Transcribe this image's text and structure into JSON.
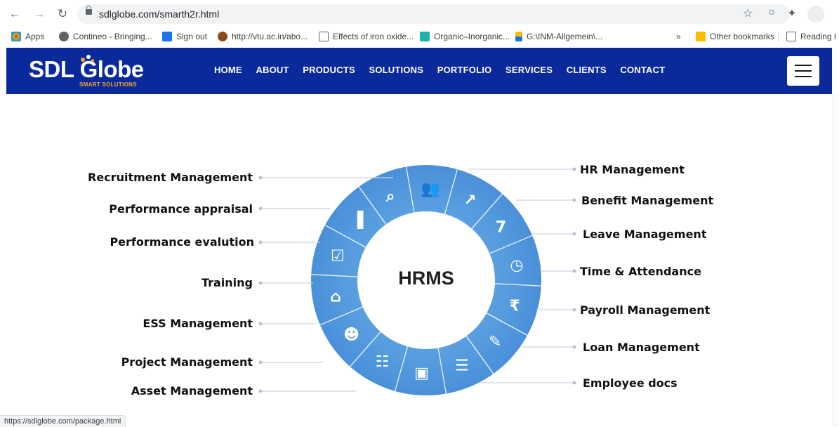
{
  "browser": {
    "url": "sdlglobe.com/smarth2r.html",
    "bookmarks": [
      {
        "label": "Apps",
        "color": "#4285f4"
      },
      {
        "label": "Contineo - Bringing...",
        "color": "#5f6368"
      },
      {
        "label": "Sign out",
        "color": "#1a73e8"
      },
      {
        "label": "http://vtu.ac.in/abo...",
        "color": "#8d4a1f"
      },
      {
        "label": "Effects of iron oxide...",
        "color": "#5f6368"
      },
      {
        "label": "Organic–Inorganic...",
        "color": "#20b2aa"
      },
      {
        "label": "G:\\INM-Allgemein\\...",
        "color": "#1a73e8"
      }
    ],
    "overflow": "»",
    "other_bookmarks": "Other bookmarks",
    "reading_list": "Reading l",
    "status_url": "https://sdlglobe.com/package.html"
  },
  "site": {
    "logo_text": "SDL Globe",
    "logo_tagline": "SMART SOLUTIONS",
    "nav": [
      "HOME",
      "ABOUT",
      "PRODUCTS",
      "SOLUTIONS",
      "PORTFOLIO",
      "SERVICES",
      "CLIENTS",
      "CONTACT"
    ],
    "brand_color": "#0a2a9c"
  },
  "diagram": {
    "center_label": "HRMS",
    "ring_color": "#4a90d9",
    "left_labels": [
      "Recruitment Management",
      "Performance appraisal",
      "Performance evalution",
      "Training",
      "ESS Management",
      "Project Management",
      "Asset Management"
    ],
    "right_labels": [
      "HR Management",
      "Benefit Management",
      "Leave Management",
      "Time & Attendance",
      "Payroll Management",
      "Loan Management",
      "Employee docs"
    ],
    "segment_icons": [
      "team-icon",
      "growth-chart-icon",
      "calendar-icon",
      "clock-icon",
      "rupee-icon",
      "loan-document-icon",
      "documents-icon",
      "asset-screen-icon",
      "org-chart-icon",
      "ess-user-icon",
      "training-board-icon",
      "evaluation-clipboard-icon",
      "appraisal-chart-icon",
      "recruitment-search-icon"
    ]
  }
}
